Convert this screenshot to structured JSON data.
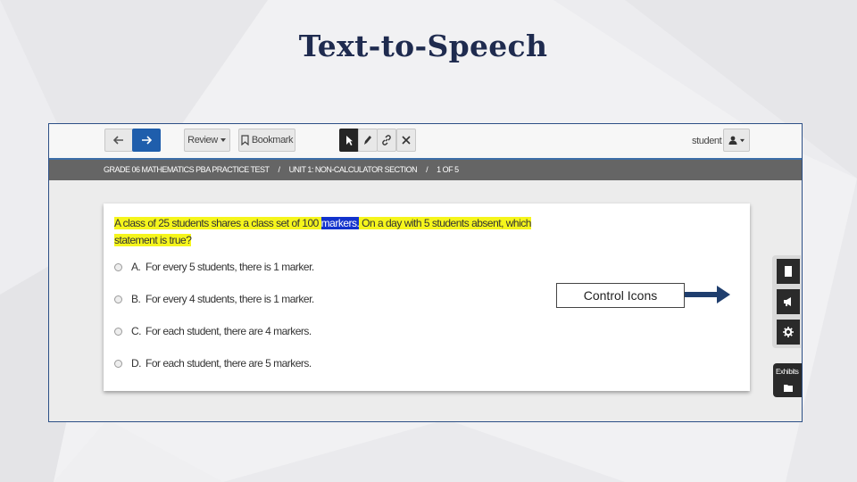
{
  "slide": {
    "title": "Text-to-Speech"
  },
  "toolbar": {
    "review_label": "Review",
    "bookmark_label": "Bookmark",
    "user_name": "student"
  },
  "breadcrumb": {
    "test": "GRADE 06 MATHEMATICS PBA PRACTICE TEST",
    "unit": "UNIT 1: NON-CALCULATOR SECTION",
    "position": "1 OF 5"
  },
  "question": {
    "stem_before": "A class of 25 students shares a class set of 100 ",
    "stem_spoken_word": "markers.",
    "stem_after": " On a day with 5 students absent, which",
    "stem_line2": "statement is true?",
    "options": [
      {
        "letter": "A.",
        "text": "For every 5 students, there is 1 marker."
      },
      {
        "letter": "B.",
        "text": "For every 4 students, there is 1 marker."
      },
      {
        "letter": "C.",
        "text": "For each student, there are 4 markers."
      },
      {
        "letter": "D.",
        "text": "For each student, there are 5 markers."
      }
    ]
  },
  "annotation": {
    "label": "Control Icons"
  },
  "side_panel": {
    "exhibits_label": "Exhibits"
  },
  "colors": {
    "title": "#1f2b4f",
    "frame_border": "#2c4f86",
    "highlight": "#f5f51c",
    "spoken_word": "#1233cc",
    "next_button": "#1f5eac",
    "arrow": "#1f3e6e"
  },
  "icons": [
    "back-arrow-icon",
    "forward-arrow-icon",
    "caret-down-icon",
    "bookmark-icon",
    "pointer-icon",
    "highlighter-icon",
    "link-icon",
    "close-icon",
    "user-icon",
    "document-icon",
    "speaker-icon",
    "gear-icon",
    "folder-icon"
  ]
}
